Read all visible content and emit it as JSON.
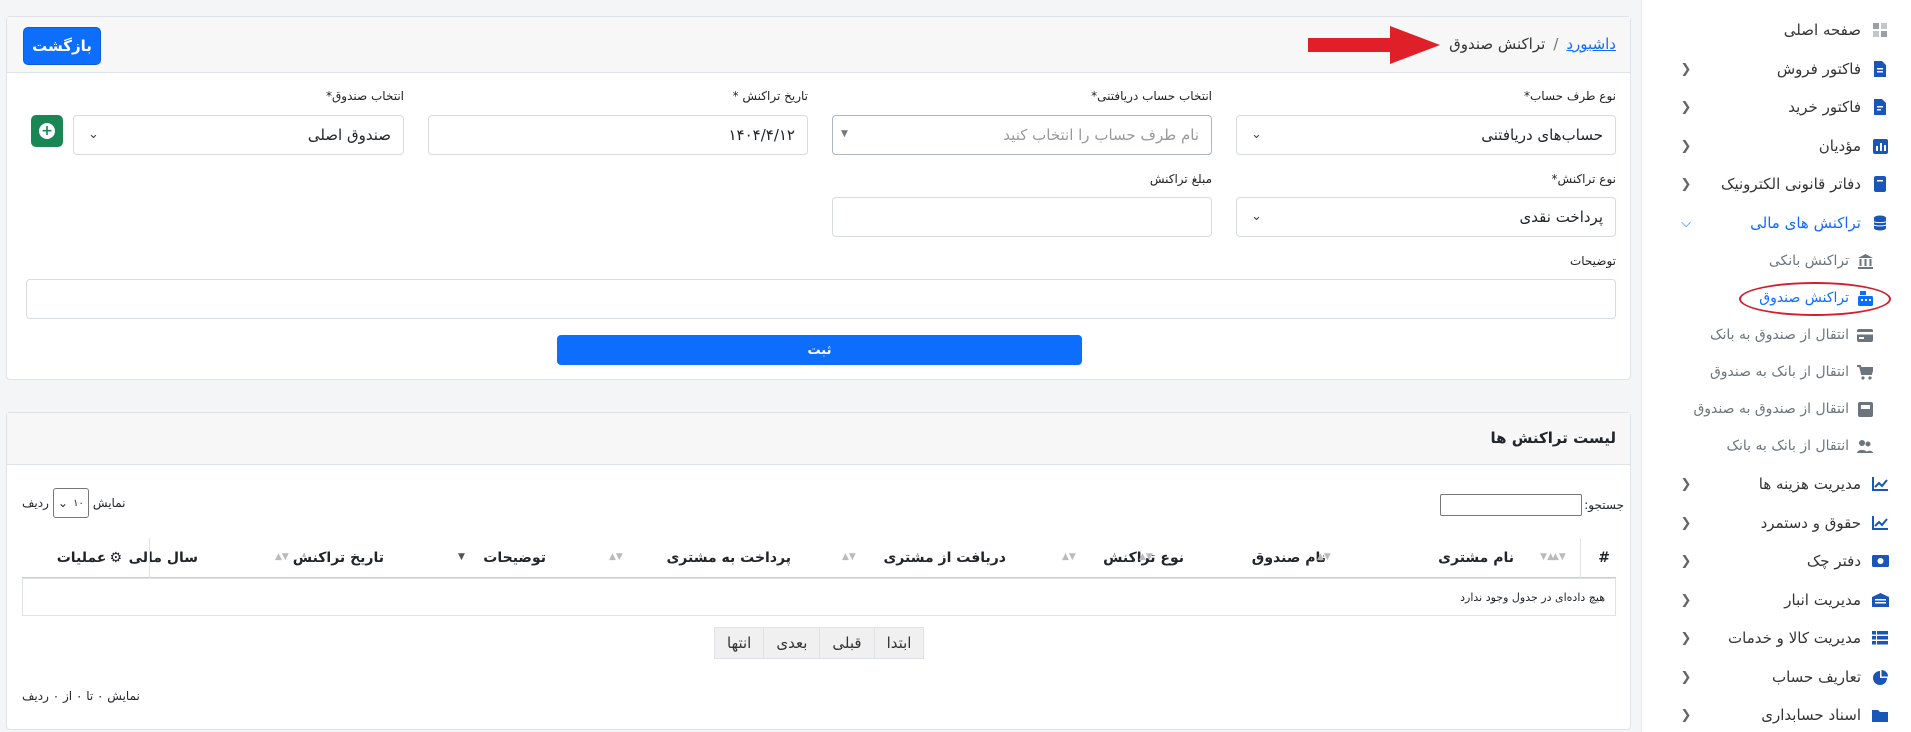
{
  "sidebar": {
    "items": [
      {
        "label": "صفحه اصلی",
        "icon": "dashboard-icon",
        "chevron": false
      },
      {
        "label": "فاکتور فروش",
        "icon": "invoice-icon",
        "chevron": true
      },
      {
        "label": "فاکتور خرید",
        "icon": "file-icon",
        "chevron": true
      },
      {
        "label": "مؤدیان",
        "icon": "chart-icon",
        "chevron": true
      },
      {
        "label": "دفاتر قانونی الکترونیک",
        "icon": "book-icon",
        "chevron": true
      },
      {
        "label": "تراکنش های مالی",
        "icon": "coins-icon",
        "chevron": true,
        "active": true
      }
    ],
    "subitems": [
      {
        "label": "تراکنش بانکی",
        "icon": "bank-icon"
      },
      {
        "label": "تراکنش صندوق",
        "icon": "cash-register-icon",
        "active": true
      },
      {
        "label": "انتقال از صندوق به بانک",
        "icon": "credit-card-icon"
      },
      {
        "label": "انتقال از بانک به صندوق",
        "icon": "cart-icon"
      },
      {
        "label": "انتقال از صندوق به صندوق",
        "icon": "box-icon"
      },
      {
        "label": "انتقال از بانک به بانک",
        "icon": "users-icon"
      }
    ],
    "items_bottom": [
      {
        "label": "مدیریت هزینه ها",
        "icon": "line-chart-icon"
      },
      {
        "label": "حقوق و دستمرد",
        "icon": "line-chart-icon"
      },
      {
        "label": "دفتر چک",
        "icon": "money-bill-icon"
      },
      {
        "label": "مدیریت انبار",
        "icon": "warehouse-icon"
      },
      {
        "label": "مدیریت کالا و خدمات",
        "icon": "list-icon"
      },
      {
        "label": "تعاریف حساب",
        "icon": "pie-chart-icon"
      },
      {
        "label": "اسناد حسابداری",
        "icon": "folder-icon"
      }
    ]
  },
  "header": {
    "back_label": "بازگشت",
    "breadcrumb_link": "داشبورد",
    "breadcrumb_sep": "/",
    "breadcrumb_current": "تراکنش صندوق"
  },
  "form": {
    "party_type_label": "نوع طرف حساب*",
    "party_type_value": "حساب‌های دریافتنی",
    "receiving_account_label": "انتخاب حساب دریافتنی*",
    "receiving_account_placeholder": "نام طرف حساب را انتخاب کنید",
    "date_label": "تاریخ تراکنش *",
    "date_value": "۱۴۰۴/۴/۱۲",
    "cashbox_label": "انتخاب صندوق*",
    "cashbox_value": "صندوق اصلی",
    "transaction_type_label": "نوع تراکنش*",
    "transaction_type_value": "پرداخت نقدی",
    "amount_label": "مبلغ تراکنش",
    "amount_value": "",
    "description_label": "توضیحات",
    "description_value": "",
    "submit_label": "ثبت",
    "add_symbol": "+"
  },
  "table": {
    "title": "لیست تراکنش ها",
    "search_label": "جستجو:",
    "length_prefix": "نمایش",
    "length_value": "۱۰",
    "length_suffix": "ردیف",
    "columns": [
      "#",
      "نام مشتری",
      "نام صندوق",
      "نوع تراکنش",
      "دریافت از مشتری",
      "پرداخت به مشتری",
      "توضیحات",
      "تاریخ تراکنش",
      "سال مالی",
      "عملیات"
    ],
    "empty_text": "هیچ داده‌ای در جدول وجود ندارد",
    "info_text": "نمایش ۰ تا ۰ از ۰ ردیف",
    "pager": [
      "ابتدا",
      "قبلی",
      "بعدی",
      "انتها"
    ]
  },
  "colors": {
    "primary": "#0d6efd",
    "success": "#198754",
    "annotation_red": "#d0202e"
  }
}
